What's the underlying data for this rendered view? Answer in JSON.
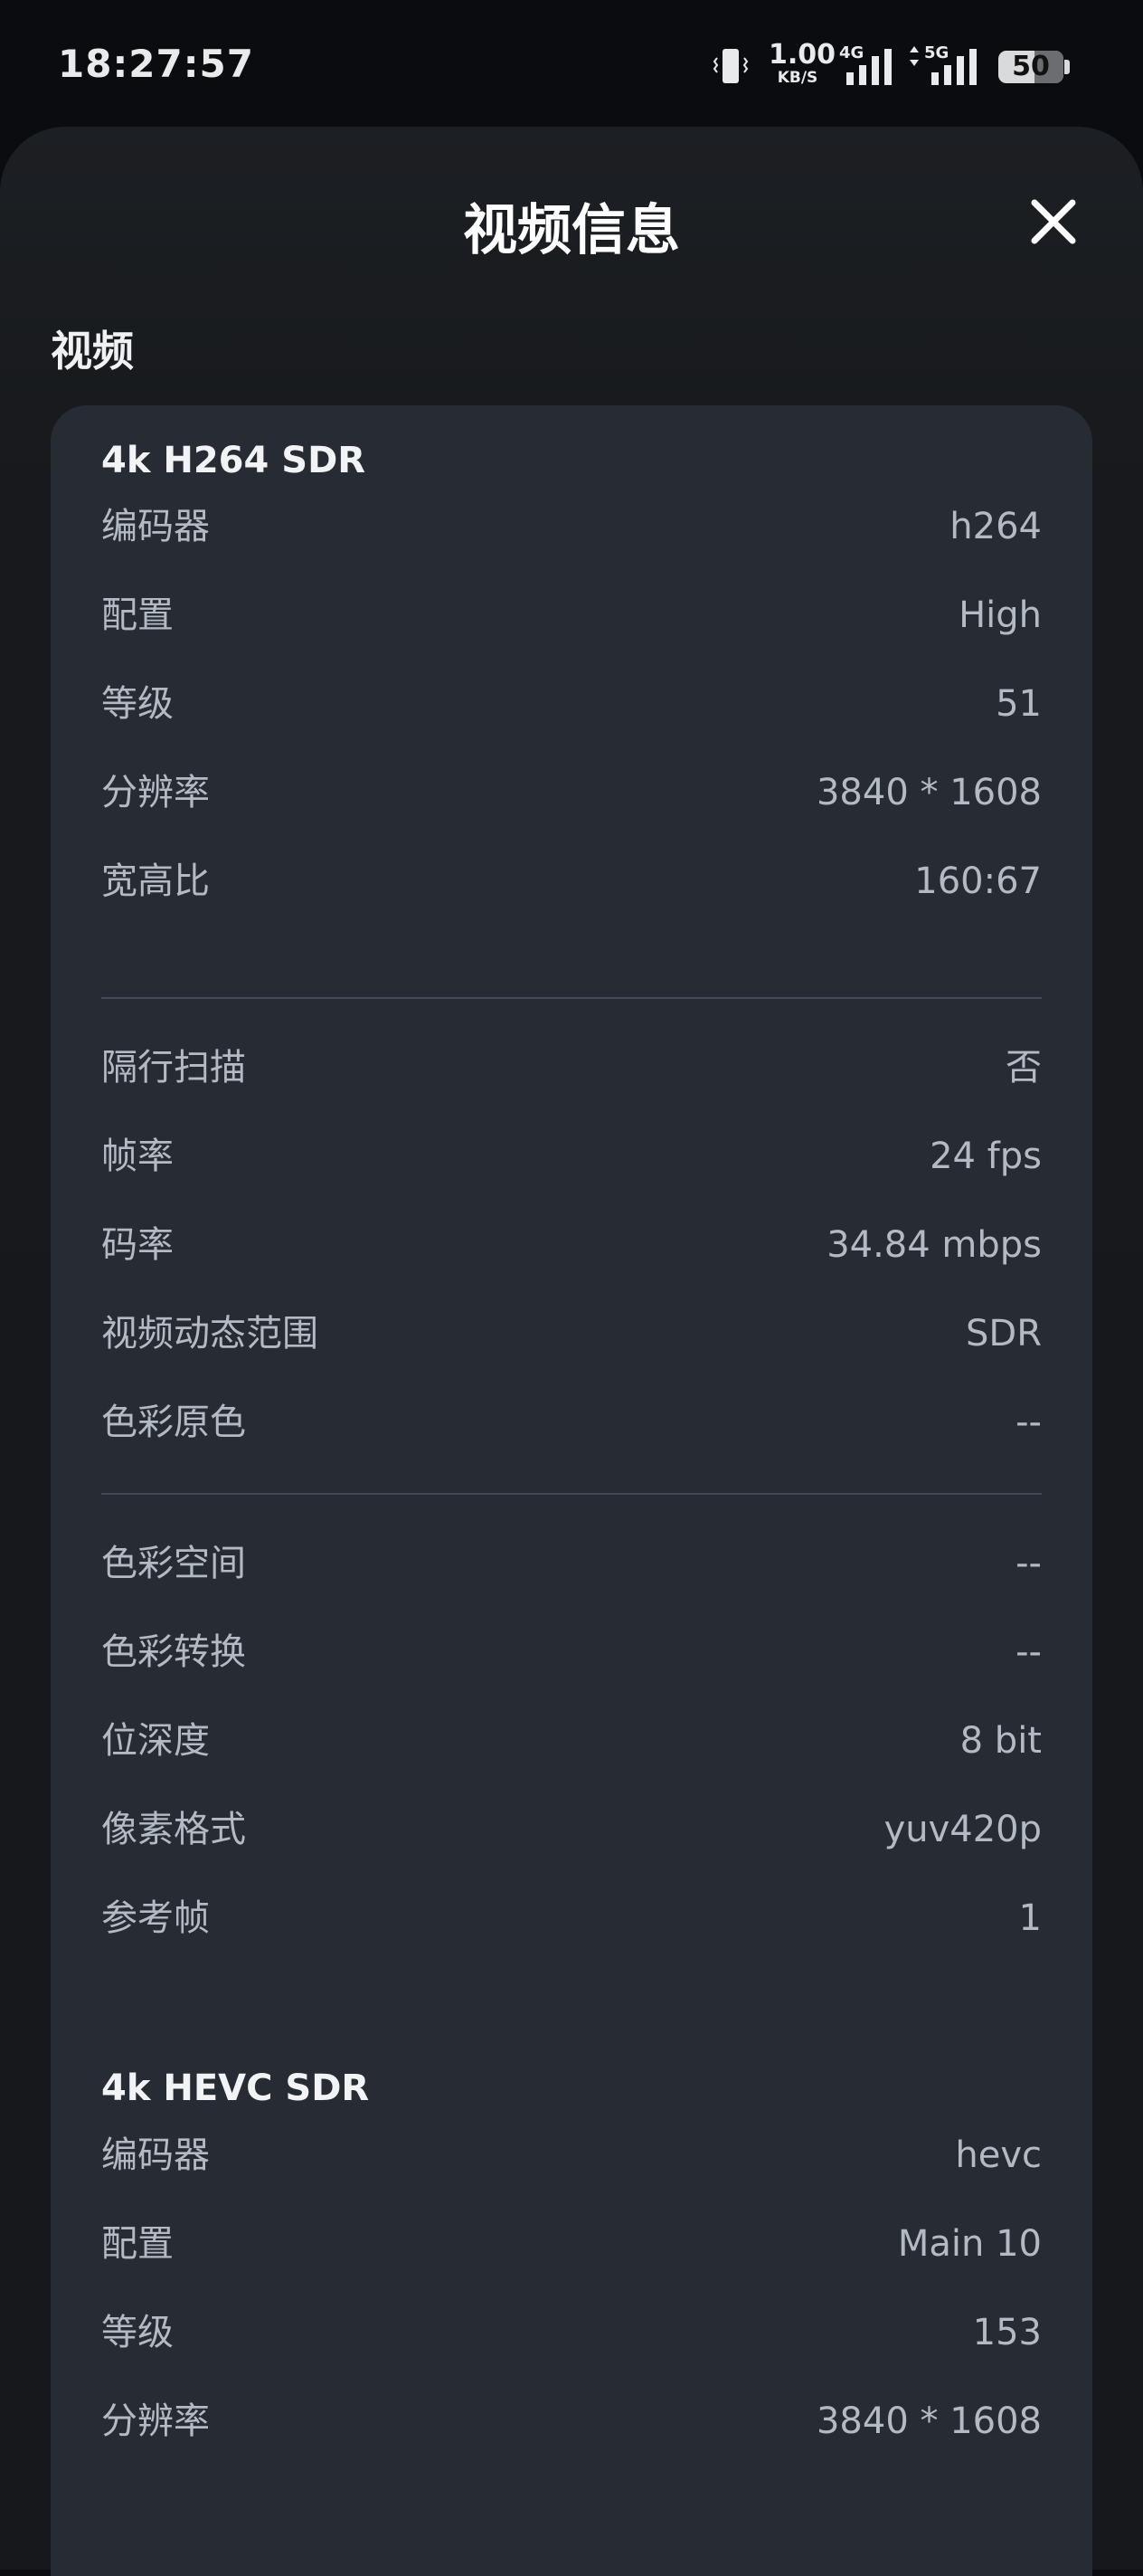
{
  "status_bar": {
    "time": "18:27:57",
    "net_speed_value": "1.00",
    "net_speed_unit": "KB/S",
    "sim1_label": "4G",
    "sim2_label": "5G",
    "battery": "50"
  },
  "sheet": {
    "title": "视频信息",
    "section_label": "视频"
  },
  "cards": [
    {
      "title": "4k H264 SDR",
      "rows": [
        {
          "k": "编码器",
          "v": "h264"
        },
        {
          "k": "配置",
          "v": "High"
        },
        {
          "k": "等级",
          "v": "51"
        },
        {
          "k": "分辨率",
          "v": "3840 * 1608"
        },
        {
          "k": "宽高比",
          "v": "160:67"
        },
        {
          "k": "隔行扫描",
          "v": "否"
        },
        {
          "k": "帧率",
          "v": "24 fps"
        },
        {
          "k": "码率",
          "v": "34.84 mbps"
        },
        {
          "k": "视频动态范围",
          "v": "SDR"
        },
        {
          "k": "色彩原色",
          "v": "--"
        },
        {
          "k": "色彩空间",
          "v": "--"
        },
        {
          "k": "色彩转换",
          "v": "--"
        },
        {
          "k": "位深度",
          "v": "8 bit"
        },
        {
          "k": "像素格式",
          "v": "yuv420p"
        },
        {
          "k": "参考帧",
          "v": "1"
        }
      ]
    },
    {
      "title": "4k HEVC SDR",
      "rows": [
        {
          "k": "编码器",
          "v": "hevc"
        },
        {
          "k": "配置",
          "v": "Main 10"
        },
        {
          "k": "等级",
          "v": "153"
        },
        {
          "k": "分辨率",
          "v": "3840 * 1608"
        }
      ]
    }
  ],
  "colors": {
    "sheet_bg": "#1c1f23",
    "card_bg": "#272c34",
    "label_text": "#b4bac4",
    "divider": "#434a55"
  },
  "icons": {
    "vibrate": "vibrate-icon",
    "signal": "signal-icon",
    "battery": "battery-icon",
    "close": "close-icon"
  }
}
